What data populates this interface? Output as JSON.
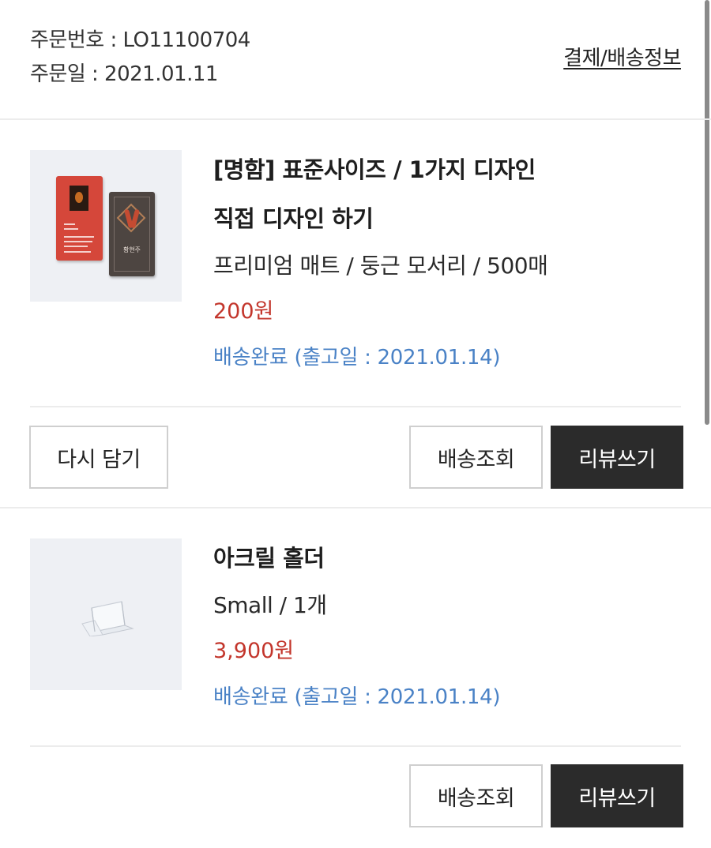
{
  "order": {
    "number_label": "주문번호 : LO11100704",
    "date_label": "주문일 : 2021.01.11",
    "detail_link": "결제/배송정보"
  },
  "items": [
    {
      "title_line1": "[명함] 표준사이즈 / 1가지 디자인",
      "title_line2": "직접 디자인 하기",
      "option": "프리미엄 매트 / 둥근 모서리 / 500매",
      "price": "200원",
      "status": "배송완료 (출고일 : 2021.01.14)",
      "thumbnail": {
        "card_back_text": "황현주"
      },
      "buttons": {
        "recart": "다시 담기",
        "track": "배송조회",
        "review": "리뷰쓰기"
      }
    },
    {
      "title": "아크릴 홀더",
      "option": "Small / 1개",
      "price": "3,900원",
      "status": "배송완료 (출고일 : 2021.01.14)",
      "buttons": {
        "track": "배송조회",
        "review": "리뷰쓰기"
      }
    }
  ],
  "colors": {
    "price": "#c3362c",
    "status": "#4a82c6",
    "dark_button": "#2b2b2b",
    "thumbnail_bg": "#eef0f4"
  }
}
